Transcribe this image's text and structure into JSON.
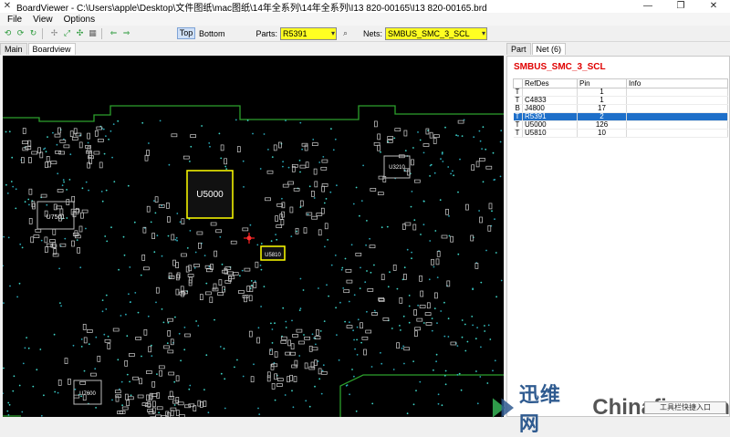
{
  "window": {
    "app_name": "BoardViewer",
    "title": "BoardViewer  -  C:\\Users\\apple\\Desktop\\文件图纸\\mac图纸\\14年全系列\\14年全系列\\I13 820-00165\\I13  820-00165.brd",
    "icon": "x-icon"
  },
  "menu": [
    "File",
    "View",
    "Options"
  ],
  "toolbar": {
    "top_label": "Top",
    "bottom_label": "Bottom",
    "parts_label": "Parts:",
    "parts_value": "R5391",
    "nets_label": "Nets:",
    "nets_value": "SMBUS_SMC_3_SCL"
  },
  "tabs": {
    "main": "Main",
    "boardview": "Boardview"
  },
  "right_tabs": {
    "part": "Part",
    "net": "Net (6)"
  },
  "net_panel": {
    "net_name": "SMBUS_SMC_3_SCL",
    "columns": [
      "",
      "RefDes",
      "Pin",
      "Info"
    ],
    "rows": [
      {
        "side": "T",
        "refdes": "",
        "pin": "1",
        "info": ""
      },
      {
        "side": "T",
        "refdes": "C4833",
        "pin": "1",
        "info": ""
      },
      {
        "side": "B",
        "refdes": "J4800",
        "pin": "17",
        "info": ""
      },
      {
        "side": "T",
        "refdes": "R5391",
        "pin": "2",
        "info": "",
        "selected": true
      },
      {
        "side": "T",
        "refdes": "U5000",
        "pin": "126",
        "info": ""
      },
      {
        "side": "T",
        "refdes": "U5810",
        "pin": "10",
        "info": ""
      }
    ]
  },
  "board_labels": {
    "u5000": "U5000",
    "u5810": "U5810",
    "u7501": "U7501",
    "u3210": "U3210",
    "u7600": "U7600"
  },
  "watermark": {
    "cn": "迅维网",
    "en": "Chinafix.com"
  },
  "task_hint": "工具栏快捷入口",
  "colors": {
    "highlight_yellow": "#ffff22",
    "selection_blue": "#1e6fc9",
    "net_red": "#e00000",
    "trace_green": "#2ca02c"
  }
}
